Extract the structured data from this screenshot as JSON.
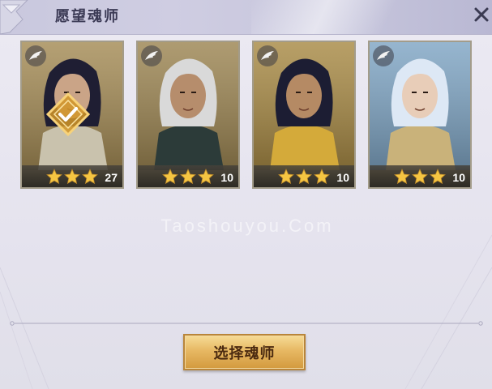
{
  "header": {
    "title": "愿望魂师"
  },
  "cards": [
    {
      "name": "card-1",
      "stars": 3,
      "level": "27",
      "selected": true,
      "bg": "#a48b55",
      "hair": "#1f1e33",
      "skin": "#caa487",
      "armor": "#c9c2ad"
    },
    {
      "name": "card-2",
      "stars": 3,
      "level": "10",
      "selected": false,
      "bg": "#9c8552",
      "hair": "#d9d9d9",
      "skin": "#b68d6c",
      "armor": "#2c3b39"
    },
    {
      "name": "card-3",
      "stars": 3,
      "level": "10",
      "selected": false,
      "bg": "#a88a45",
      "hair": "#1c1d33",
      "skin": "#b58a64",
      "armor": "#d4aa3a"
    },
    {
      "name": "card-4",
      "stars": 3,
      "level": "10",
      "selected": false,
      "bg": "#7fa5c4",
      "hair": "#dde8f5",
      "skin": "#e8cdb8",
      "armor": "#c9b27a"
    }
  ],
  "watermark": "Taoshouyou.Com",
  "select_button": {
    "label": "选择魂师"
  },
  "colors": {
    "accent_gold": "#e7b863",
    "star": "#f5c542",
    "panel": "#e5e3ee"
  }
}
